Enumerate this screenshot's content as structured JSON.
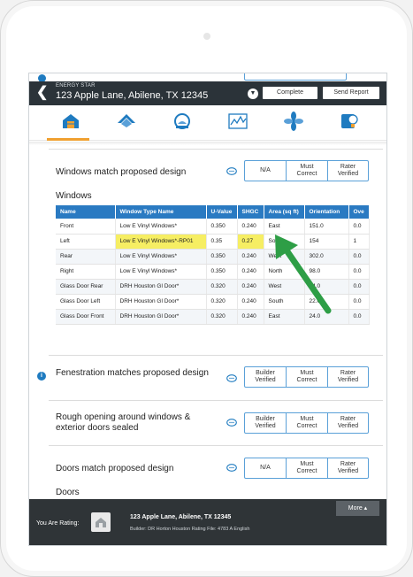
{
  "header": {
    "program": "ENERGY STAR",
    "address": "123 Apple Lane, Abilene, TX 12345",
    "complete_label": "Complete",
    "send_report_label": "Send Report"
  },
  "tabs": [
    {
      "icon": "house-insulation-icon",
      "active": true
    },
    {
      "icon": "roof-icon",
      "active": false
    },
    {
      "icon": "water-heater-icon",
      "active": false
    },
    {
      "icon": "graph-icon",
      "active": false
    },
    {
      "icon": "fan-icon",
      "active": false
    },
    {
      "icon": "appliance-lightbulb-icon",
      "active": false
    }
  ],
  "sections": {
    "windows_match": {
      "title": "Windows match proposed design",
      "options": [
        "N/A",
        "Must\nCorrect",
        "Rater\nVerified"
      ]
    },
    "windows_table": {
      "title": "Windows",
      "columns": [
        "Name",
        "Window Type Name",
        "U-Value",
        "SHGC",
        "Area (sq ft)",
        "Orientation",
        "Ove"
      ],
      "rows": [
        [
          "Front",
          "Low E Vinyl Windows*",
          "0.350",
          "0.240",
          "East",
          "151.0",
          "0.0"
        ],
        [
          "Left",
          "Low E Vinyl Windows*-RP01",
          "0.35",
          "0.27",
          "South",
          "154",
          "1"
        ],
        [
          "Rear",
          "Low E Vinyl Windows*",
          "0.350",
          "0.240",
          "West",
          "302.0",
          "0.0"
        ],
        [
          "Right",
          "Low E Vinyl Windows*",
          "0.350",
          "0.240",
          "North",
          "98.0",
          "0.0"
        ],
        [
          "Glass Door Rear",
          "DRH Houston Gl Door*",
          "0.320",
          "0.240",
          "West",
          "24.0",
          "0.0"
        ],
        [
          "Glass Door Left",
          "DRH Houston Gl Door*",
          "0.320",
          "0.240",
          "South",
          "22.0",
          "0.0"
        ],
        [
          "Glass Door Front",
          "DRH Houston Gl Door*",
          "0.320",
          "0.240",
          "East",
          "24.0",
          "0.0"
        ]
      ]
    },
    "fenestration": {
      "title": "Fenestration matches proposed design",
      "options": [
        "Builder\nVerified",
        "Must\nCorrect",
        "Rater\nVerified"
      ]
    },
    "rough_opening": {
      "title": "Rough opening around windows & exterior doors sealed",
      "options": [
        "Builder\nVerified",
        "Must\nCorrect",
        "Rater\nVerified"
      ]
    },
    "doors_match": {
      "title": "Doors match proposed design",
      "options": [
        "N/A",
        "Must\nCorrect",
        "Rater\nVerified"
      ]
    },
    "doors_table": {
      "title": "Doors"
    }
  },
  "footer": {
    "you_are_rating": "You Are Rating:",
    "address": "123 Apple Lane, Abilene, TX 12345",
    "builder_line": "Builder: DR Horton Houston  Rating File: 4783 A English",
    "more_label": "More ▴"
  },
  "colors": {
    "accent_blue": "#2a7ac2",
    "tab_underline": "#f0a030",
    "highlight": "#f6ee63",
    "dark_bar": "#2b3339",
    "arrow_green": "#2e9e46"
  }
}
